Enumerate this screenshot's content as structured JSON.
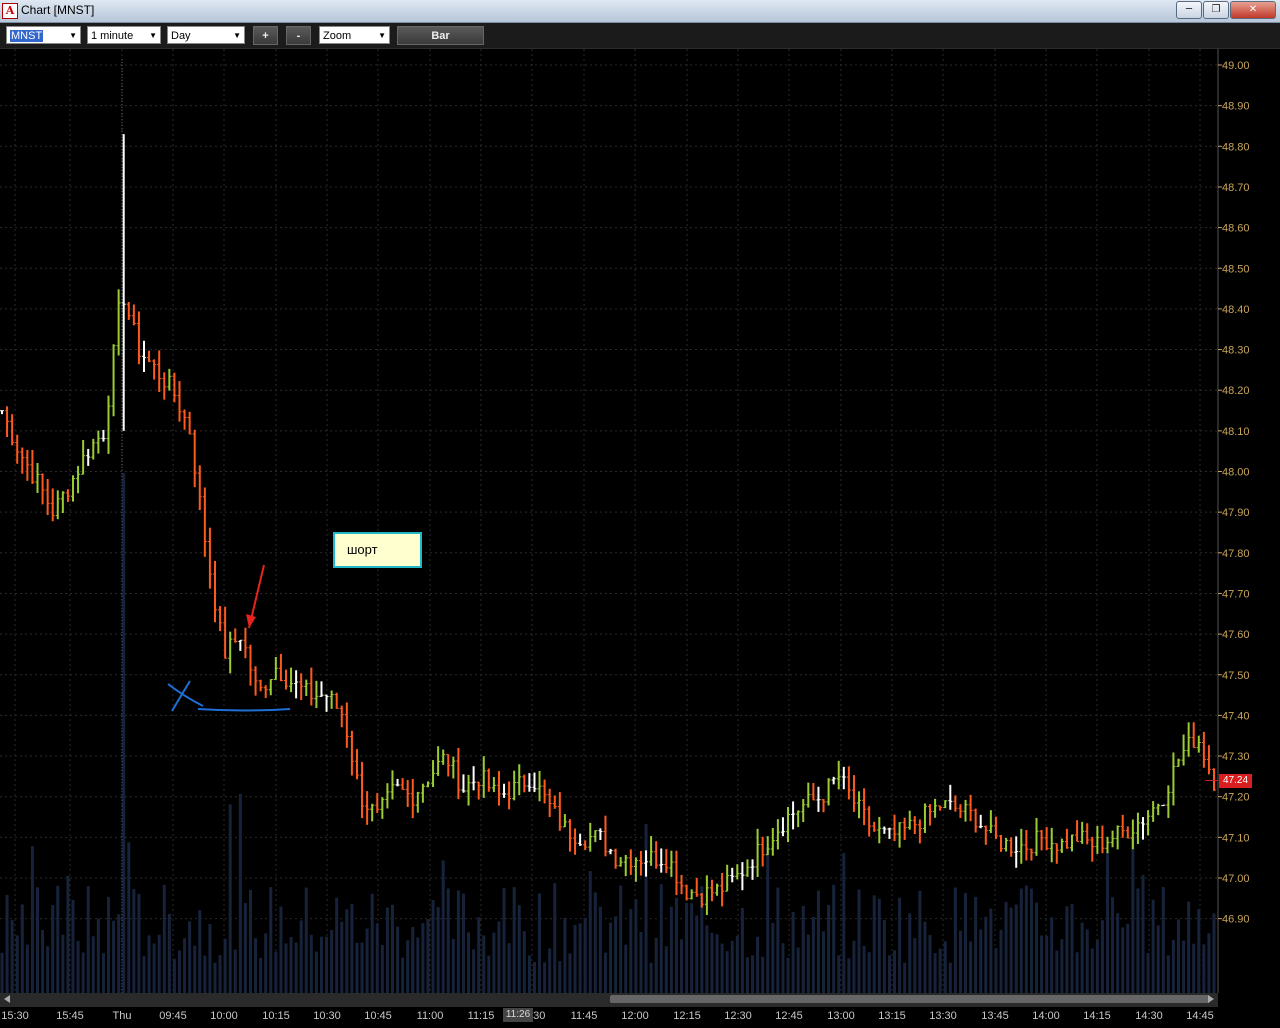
{
  "window": {
    "title": "Chart [MNST]",
    "icon": "A",
    "buttons": {
      "minimize": "─",
      "maximize": "❐",
      "close": "✕"
    }
  },
  "toolbar": {
    "symbol": "MNST",
    "interval": "1 minute",
    "range": "Day",
    "zoom_in": "+",
    "zoom_out": "-",
    "zoom_mode": "Zoom",
    "bar_type": "Bar"
  },
  "annotation": {
    "note_text": "шорт"
  },
  "last_price": "47.24",
  "cursor_time": "11:26",
  "colors": {
    "up": "#9acd32",
    "down": "#ff5a1e",
    "neutral": "#ffffff",
    "grid": "#2a2a2a",
    "volume": "#16233a",
    "note_border": "#22b7c7",
    "arrow": "#e8221e",
    "pen": "#1f6fd6"
  },
  "chart_data": {
    "type": "bar",
    "symbol": "MNST",
    "interval": "1 minute",
    "y_ticks": [
      "49.00",
      "48.90",
      "48.80",
      "48.70",
      "48.60",
      "48.50",
      "48.40",
      "48.30",
      "48.20",
      "48.10",
      "48.00",
      "47.90",
      "47.80",
      "47.70",
      "47.60",
      "47.50",
      "47.40",
      "47.30",
      "47.20",
      "47.10",
      "47.00",
      "46.90"
    ],
    "ylim": [
      46.85,
      49.0
    ],
    "x_ticks": [
      "15:30",
      "15:45",
      "Thu",
      "09:45",
      "10:00",
      "10:15",
      "10:30",
      "10:45",
      "11:00",
      "11:15",
      "11:30",
      "11:45",
      "12:00",
      "12:15",
      "12:30",
      "12:45",
      "13:00",
      "13:15",
      "13:30",
      "13:45",
      "14:00",
      "14:15",
      "14:30",
      "14:45"
    ],
    "close_path": [
      [
        "15:30",
        48.15
      ],
      [
        "15:35",
        48.05
      ],
      [
        "15:40",
        47.98
      ],
      [
        "15:45",
        47.9
      ],
      [
        "15:50",
        47.97
      ],
      [
        "15:55",
        48.05
      ],
      [
        "16:00",
        48.1
      ],
      [
        "09:30",
        48.45
      ],
      [
        "09:35",
        48.3
      ],
      [
        "09:40",
        48.25
      ],
      [
        "09:45",
        48.2
      ],
      [
        "09:50",
        48.1
      ],
      [
        "09:55",
        47.8
      ],
      [
        "10:00",
        47.55
      ],
      [
        "10:05",
        47.6
      ],
      [
        "10:10",
        47.45
      ],
      [
        "10:15",
        47.52
      ],
      [
        "10:20",
        47.48
      ],
      [
        "10:25",
        47.45
      ],
      [
        "10:30",
        47.45
      ],
      [
        "10:35",
        47.4
      ],
      [
        "10:40",
        47.2
      ],
      [
        "10:45",
        47.15
      ],
      [
        "10:50",
        47.22
      ],
      [
        "10:55",
        47.2
      ],
      [
        "11:00",
        47.25
      ],
      [
        "11:05",
        47.3
      ],
      [
        "11:10",
        47.22
      ],
      [
        "11:15",
        47.25
      ],
      [
        "11:20",
        47.2
      ],
      [
        "11:25",
        47.22
      ],
      [
        "11:30",
        47.25
      ],
      [
        "11:35",
        47.18
      ],
      [
        "11:40",
        47.12
      ],
      [
        "11:45",
        47.1
      ],
      [
        "11:50",
        47.1
      ],
      [
        "11:55",
        47.05
      ],
      [
        "12:00",
        47.05
      ],
      [
        "12:05",
        47.05
      ],
      [
        "12:10",
        47.05
      ],
      [
        "12:15",
        46.97
      ],
      [
        "12:20",
        46.96
      ],
      [
        "12:25",
        46.97
      ],
      [
        "12:30",
        47.0
      ],
      [
        "12:35",
        47.05
      ],
      [
        "12:40",
        47.1
      ],
      [
        "12:45",
        47.15
      ],
      [
        "12:50",
        47.18
      ],
      [
        "12:55",
        47.2
      ],
      [
        "13:00",
        47.25
      ],
      [
        "13:05",
        47.18
      ],
      [
        "13:10",
        47.12
      ],
      [
        "13:15",
        47.1
      ],
      [
        "13:20",
        47.12
      ],
      [
        "13:25",
        47.15
      ],
      [
        "13:30",
        47.18
      ],
      [
        "13:35",
        47.17
      ],
      [
        "13:40",
        47.15
      ],
      [
        "13:45",
        47.1
      ],
      [
        "13:50",
        47.08
      ],
      [
        "13:55",
        47.08
      ],
      [
        "14:00",
        47.1
      ],
      [
        "14:05",
        47.08
      ],
      [
        "14:10",
        47.1
      ],
      [
        "14:15",
        47.08
      ],
      [
        "14:20",
        47.1
      ],
      [
        "14:25",
        47.12
      ],
      [
        "14:30",
        47.15
      ],
      [
        "14:35",
        47.2
      ],
      [
        "14:40",
        47.3
      ],
      [
        "14:45",
        47.35
      ],
      [
        "14:50",
        47.24
      ]
    ],
    "high": 48.83,
    "low": 46.91,
    "last": 47.24,
    "grid": true
  }
}
